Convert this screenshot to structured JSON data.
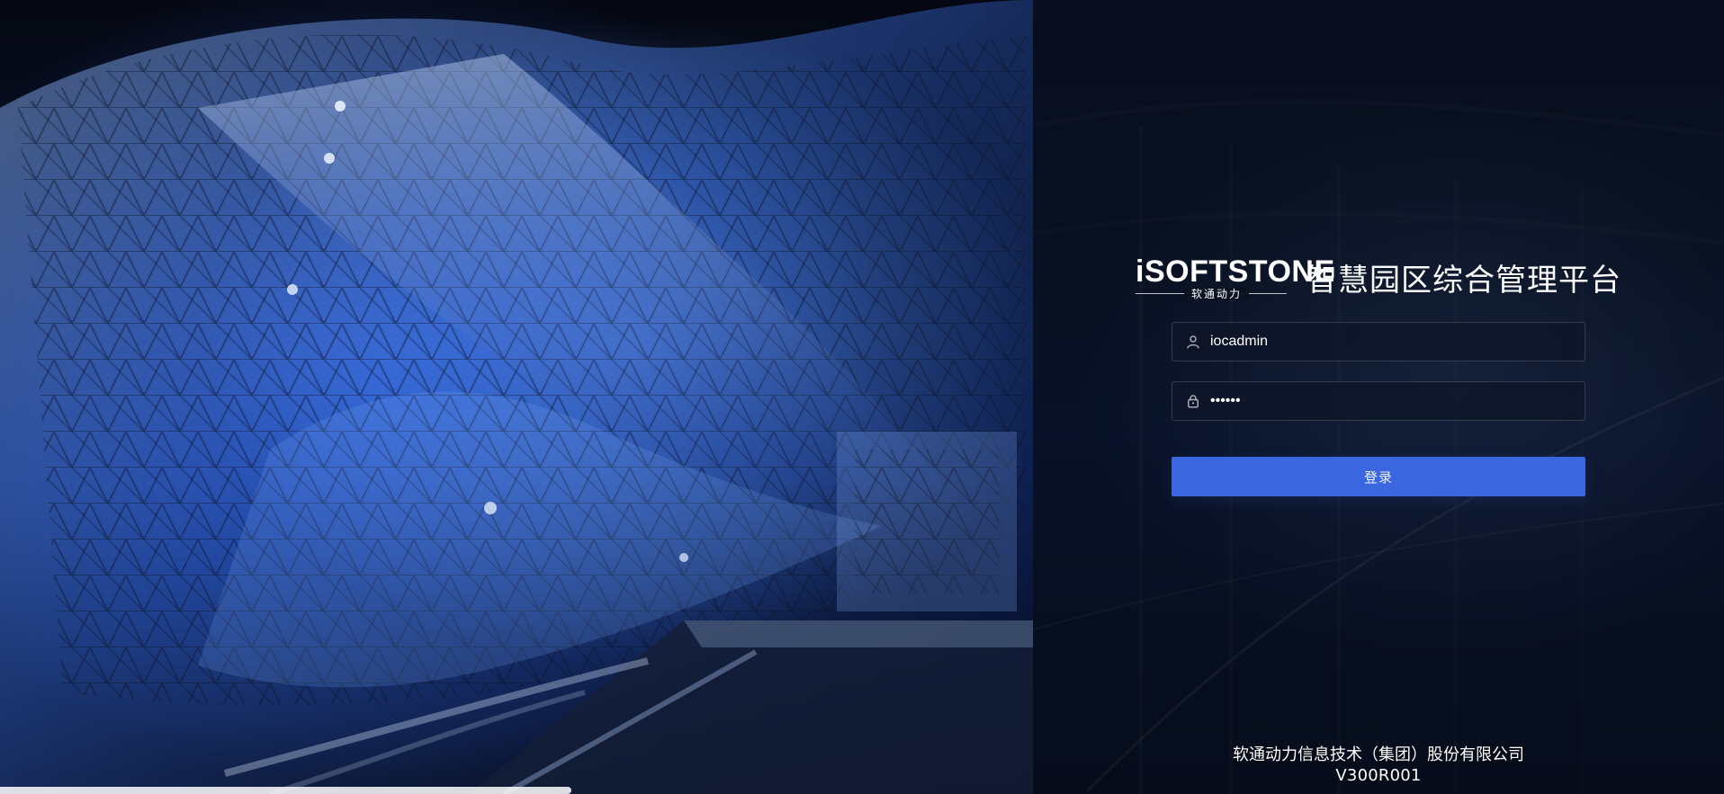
{
  "brand": {
    "logo_text": "iSOFTSTONE",
    "logo_sub": "软通动力",
    "platform_title": "智慧园区综合管理平台"
  },
  "login": {
    "username_value": "iocadmin",
    "password_value": "••••••",
    "login_button_label": "登录"
  },
  "footer": {
    "company": "软通动力信息技术（集团）股份有限公司",
    "version": "V300R001"
  },
  "colors": {
    "primary_button": "#3a66e0",
    "panel_bg": "#0b1426",
    "text": "#ffffff"
  },
  "icons": {
    "username": "user-icon",
    "password": "lock-icon"
  }
}
